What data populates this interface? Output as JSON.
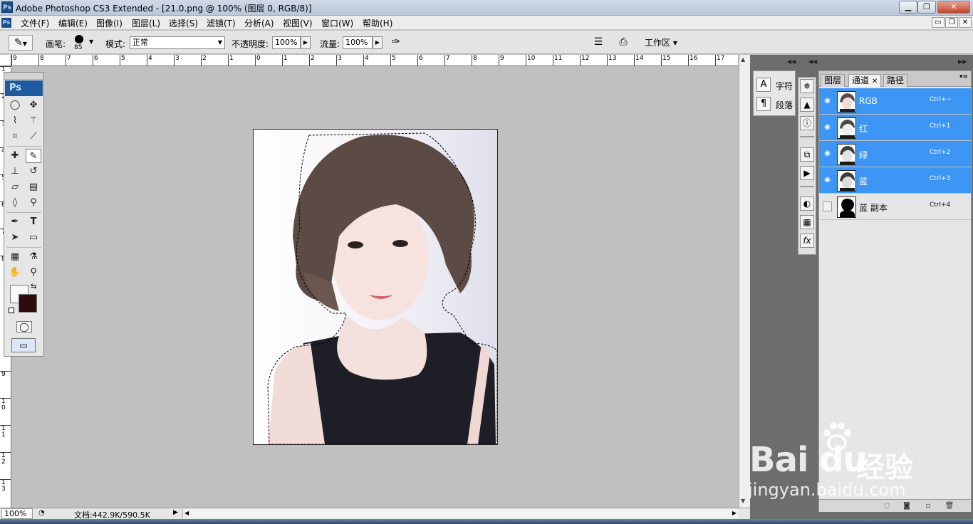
{
  "window": {
    "app_icon": "Ps",
    "title": "Adobe Photoshop CS3 Extended - [21.0.png @ 100% (图层 0, RGB/8)]",
    "buttons": {
      "minimize": "▁",
      "restore": "❐",
      "close": "✕"
    }
  },
  "menubar": {
    "items": [
      "文件(F)",
      "编辑(E)",
      "图像(I)",
      "图层(L)",
      "选择(S)",
      "滤镜(T)",
      "分析(A)",
      "视图(V)",
      "窗口(W)",
      "帮助(H)"
    ],
    "doc_buttons": {
      "minimize": "▭",
      "restore": "❐",
      "close": "✕"
    }
  },
  "options": {
    "brush_label": "画笔:",
    "brush_size": "85",
    "mode_label": "模式:",
    "mode_value": "正常",
    "opacity_label": "不透明度:",
    "opacity_value": "100%",
    "flow_label": "流量:",
    "flow_value": "100%",
    "workspace_label": "工作区 ▾"
  },
  "ruler": {
    "top_ticks": [
      "9",
      "8",
      "7",
      "6",
      "5",
      "4",
      "3",
      "2",
      "1",
      "0",
      "1",
      "2",
      "3",
      "4",
      "5",
      "6",
      "7",
      "8",
      "9",
      "10",
      "11",
      "12",
      "13",
      "14",
      "15",
      "16",
      "17"
    ],
    "left_ticks": [
      "1",
      "2",
      "3",
      "4",
      "5",
      "6",
      "7",
      "8",
      "9",
      "1\n0",
      "1\n1",
      "1\n2",
      "1\n3"
    ]
  },
  "toolbox": {
    "logo": "Ps"
  },
  "status": {
    "zoom": "100%",
    "doc_info": "文档:442.9K/590.5K"
  },
  "char_panel": {
    "character_label": "字符",
    "paragraph_label": "段落"
  },
  "channels_panel": {
    "tabs": [
      "图层",
      "通道",
      "路径"
    ],
    "channels": [
      {
        "name": "RGB",
        "shortcut": "Ctrl+~",
        "selected": true,
        "visible": true
      },
      {
        "name": "红",
        "shortcut": "Ctrl+1",
        "selected": true,
        "visible": true
      },
      {
        "name": "绿",
        "shortcut": "Ctrl+2",
        "selected": true,
        "visible": true
      },
      {
        "name": "蓝",
        "shortcut": "Ctrl+3",
        "selected": true,
        "visible": true
      },
      {
        "name": "蓝 副本",
        "shortcut": "Ctrl+4",
        "selected": false,
        "visible": false
      }
    ]
  },
  "watermark": {
    "main": "Bai  du",
    "cn": "经验",
    "url": "jingyan.baidu.com"
  },
  "colors": {
    "accent_selection": "#3d96f4",
    "background_color_swatch": "#2a0c0e",
    "foreground_color_swatch": "#f8f8f8"
  }
}
